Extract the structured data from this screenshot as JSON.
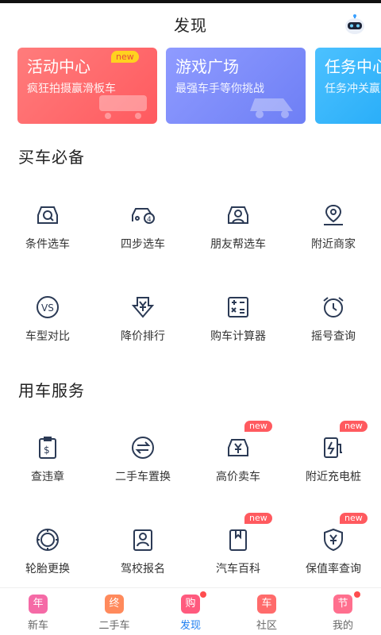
{
  "header": {
    "title": "发现"
  },
  "banners": [
    {
      "title": "活动中心",
      "subtitle": "疯狂拍摄赢滑板车",
      "badge": "new"
    },
    {
      "title": "游戏广场",
      "subtitle": "最强车手等你挑战"
    },
    {
      "title": "任务中心",
      "subtitle": "任务冲关赢"
    }
  ],
  "sections": {
    "buy": {
      "title": "买车必备",
      "items": [
        {
          "label": "条件选车",
          "icon": "car-search-icon"
        },
        {
          "label": "四步选车",
          "icon": "car-four-icon"
        },
        {
          "label": "朋友帮选车",
          "icon": "friend-help-icon"
        },
        {
          "label": "附近商家",
          "icon": "location-pin-icon"
        },
        {
          "label": "车型对比",
          "icon": "vs-icon"
        },
        {
          "label": "降价排行",
          "icon": "price-down-icon"
        },
        {
          "label": "购车计算器",
          "icon": "calculator-icon"
        },
        {
          "label": "摇号查询",
          "icon": "alarm-clock-icon"
        }
      ]
    },
    "service": {
      "title": "用车服务",
      "items": [
        {
          "label": "查违章",
          "icon": "violation-icon"
        },
        {
          "label": "二手车置换",
          "icon": "swap-icon"
        },
        {
          "label": "高价卖车",
          "icon": "sell-car-icon",
          "badge": "new"
        },
        {
          "label": "附近充电桩",
          "icon": "charger-icon",
          "badge": "new"
        },
        {
          "label": "轮胎更换",
          "icon": "tire-icon"
        },
        {
          "label": "驾校报名",
          "icon": "driving-school-icon"
        },
        {
          "label": "汽车百科",
          "icon": "book-icon",
          "badge": "new"
        },
        {
          "label": "保值率查询",
          "icon": "shield-yen-icon",
          "badge": "new"
        }
      ]
    }
  },
  "tabbar": {
    "items": [
      {
        "label": "新车",
        "glyph": "年",
        "color": "#f56aa6"
      },
      {
        "label": "二手车",
        "glyph": "终",
        "color": "#ff8a5c"
      },
      {
        "label": "发现",
        "glyph": "购",
        "color": "#ff5a7e",
        "active": true,
        "dot": true
      },
      {
        "label": "社区",
        "glyph": "车",
        "color": "#ff6b6b"
      },
      {
        "label": "我的",
        "glyph": "节",
        "color": "#ff6f8e",
        "dot": true
      }
    ]
  },
  "colors": {
    "accent": "#1f7ff0",
    "icon_stroke": "#2b3a55",
    "new_badge": "#ff5a5f"
  }
}
